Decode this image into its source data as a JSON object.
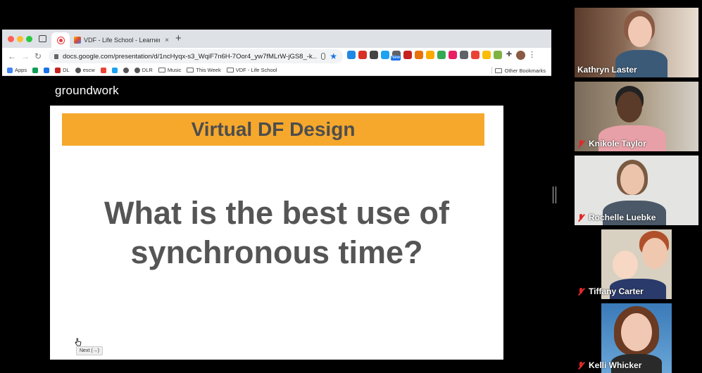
{
  "browser": {
    "pinned_tab_icon": "red-circle-icon",
    "active_tab_title": "VDF - Life School - Learner W...",
    "tab_close": "×",
    "new_tab": "+",
    "url": "docs.google.com/presentation/d/1ncHyqx-s3_WqiF7n6H-7Oor4_yw7fMLrW-jGS8_-k...",
    "ext_new_badge": "New",
    "bookmarks": [
      {
        "label": "Apps",
        "icon": "apps-grid-icon"
      },
      {
        "label": "",
        "icon": "drive-icon"
      },
      {
        "label": "",
        "icon": "classroom-icon"
      },
      {
        "label": "DL",
        "icon": "dl-icon"
      },
      {
        "label": "escw",
        "icon": "globe-icon"
      },
      {
        "label": "",
        "icon": "gmail-icon"
      },
      {
        "label": "",
        "icon": "twitter-icon"
      },
      {
        "label": "",
        "icon": "globe-icon"
      },
      {
        "label": "DLR",
        "icon": "globe-icon"
      },
      {
        "label": "Music",
        "icon": "folder-icon"
      },
      {
        "label": "This Week",
        "icon": "folder-icon"
      },
      {
        "label": "VDF - Life School",
        "icon": "folder-icon"
      }
    ],
    "other_bookmarks": "Other Bookmarks"
  },
  "presentation": {
    "brand": "groundwork",
    "banner": "Virtual DF Design",
    "question_line1": "What is the best use of",
    "question_line2": "synchronous time?",
    "next_tooltip": "Next (→)"
  },
  "participants": [
    {
      "name": "Kathryn Laster",
      "muted": false
    },
    {
      "name": "Knikole Taylor",
      "muted": true
    },
    {
      "name": "Rochelle Luebke",
      "muted": true
    },
    {
      "name": "Tiffany Carter",
      "muted": true
    },
    {
      "name": "Kelli Whicker",
      "muted": true
    }
  ],
  "colors": {
    "banner": "#f6a82c",
    "slide_text": "#555555",
    "mute": "#e02828"
  }
}
